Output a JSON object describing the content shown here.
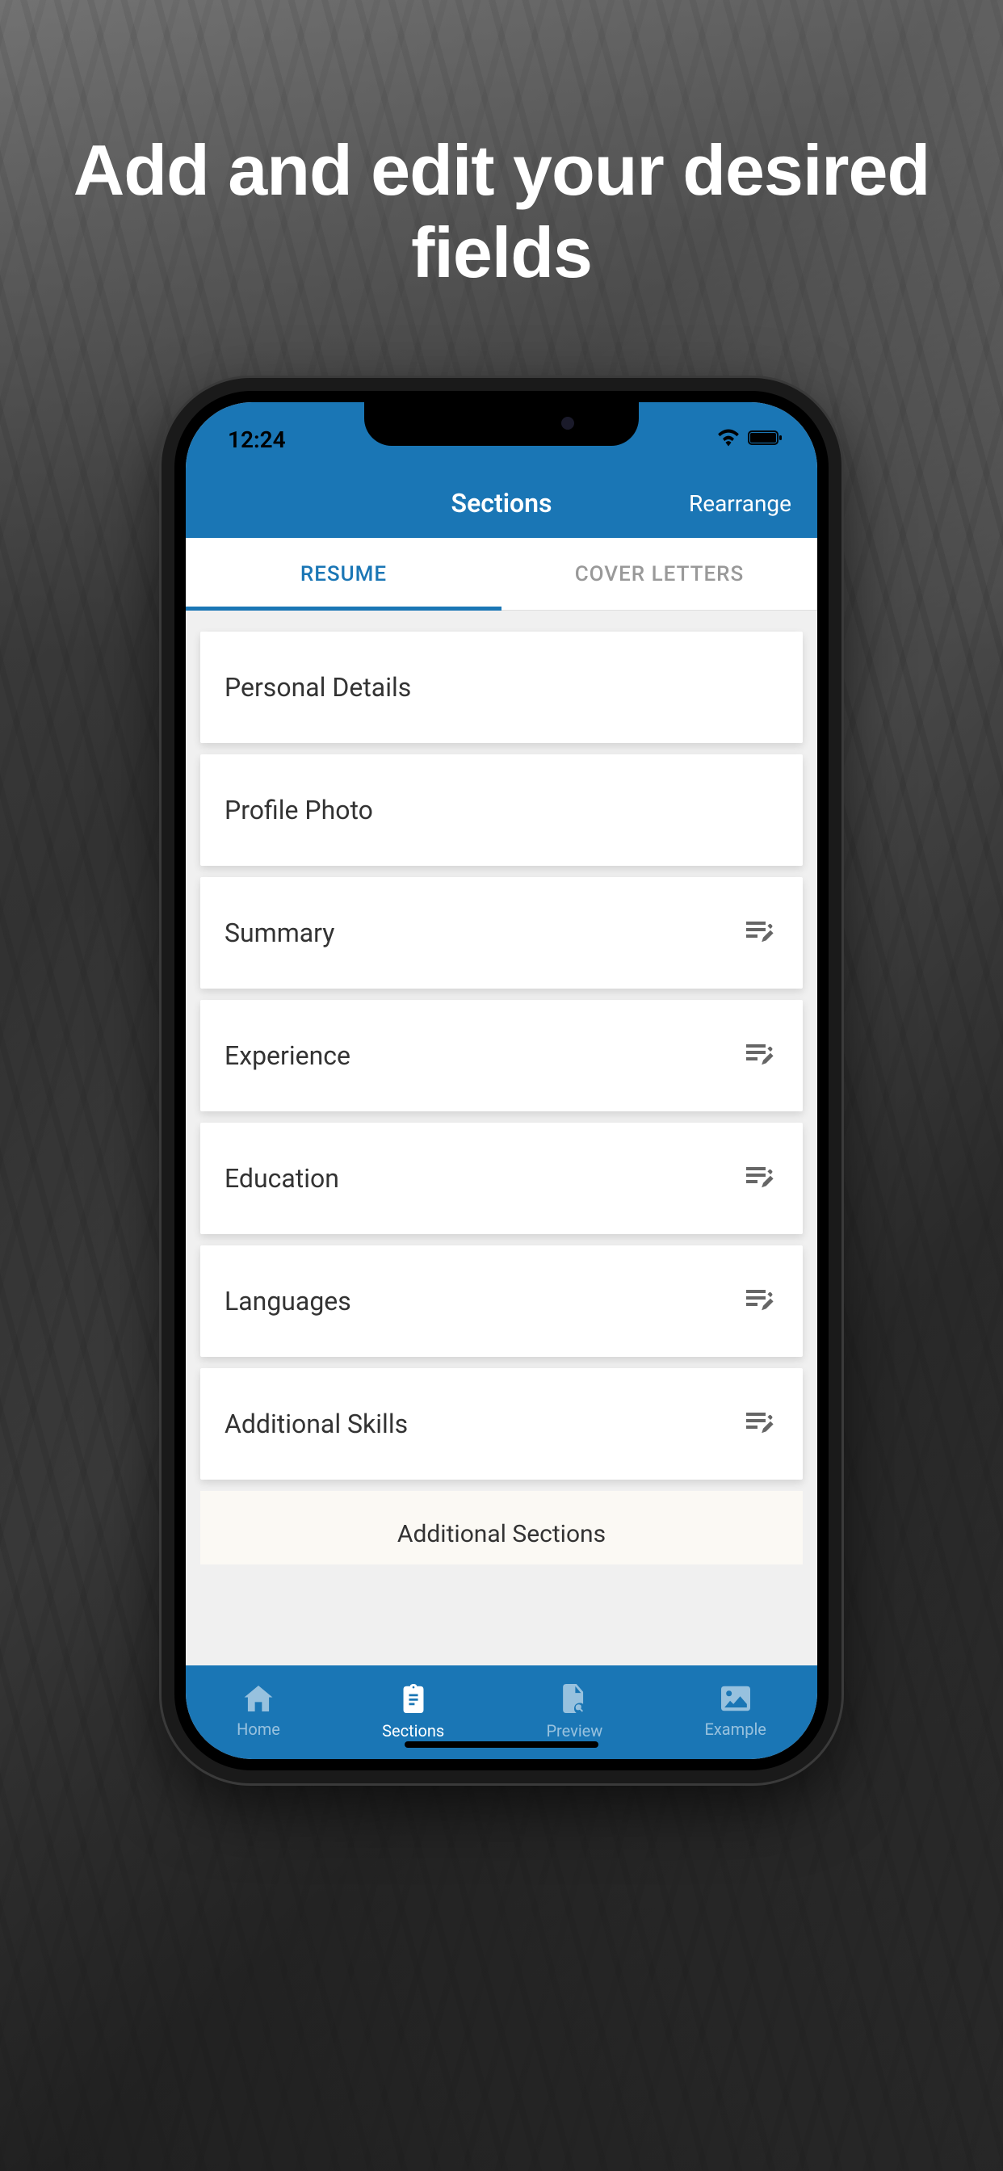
{
  "promo": {
    "title": "Add and edit your desired fields"
  },
  "status": {
    "time": "12:24"
  },
  "header": {
    "title": "Sections",
    "action": "Rearrange"
  },
  "tabs": {
    "resume": "RESUME",
    "coverLetters": "COVER LETTERS"
  },
  "sections": {
    "personalDetails": "Personal Details",
    "profilePhoto": "Profile Photo",
    "summary": "Summary",
    "experience": "Experience",
    "education": "Education",
    "languages": "Languages",
    "additionalSkills": "Additional Skills",
    "additionalHeader": "Additional Sections"
  },
  "nav": {
    "home": "Home",
    "sections": "Sections",
    "preview": "Preview",
    "example": "Example"
  }
}
